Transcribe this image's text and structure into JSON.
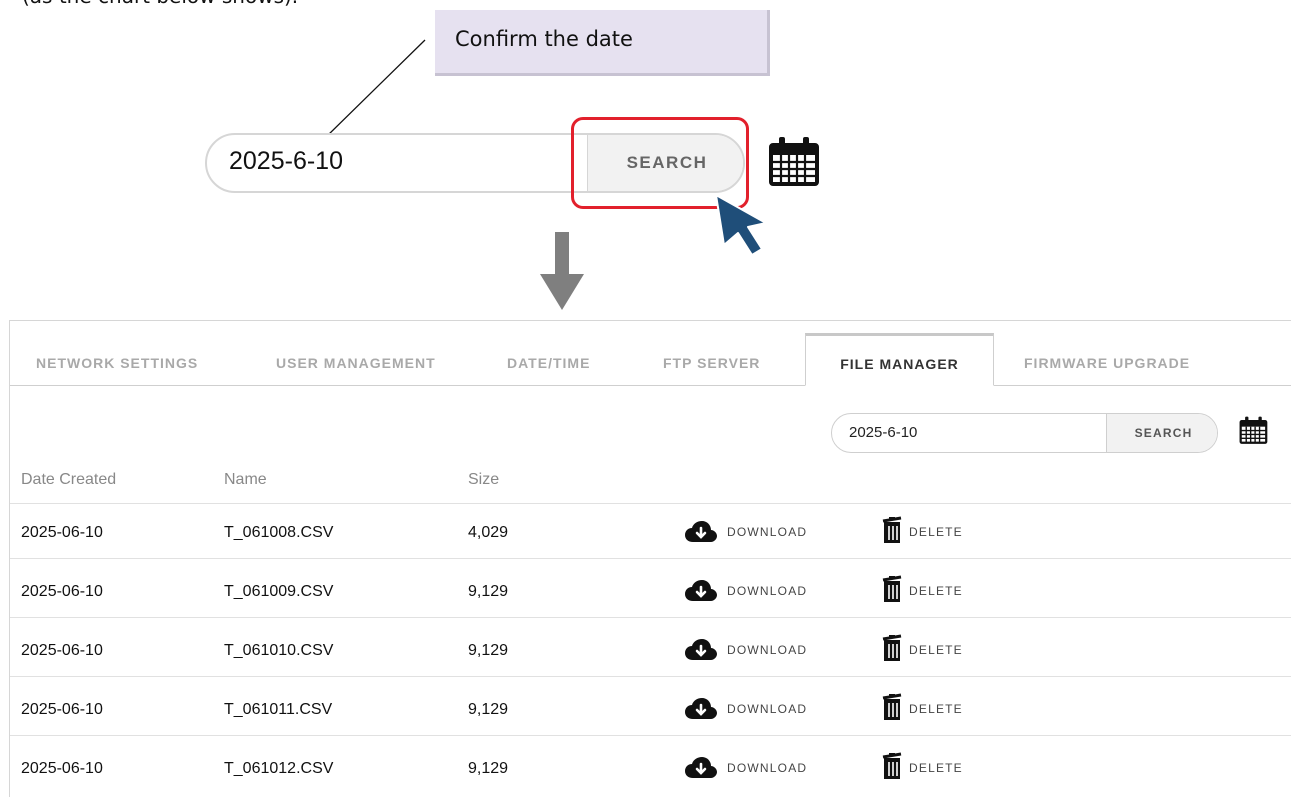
{
  "intro_text": "(as the chart below shows).",
  "callout": {
    "text": "Confirm the date"
  },
  "zoomed_search": {
    "value": "2025-6-10",
    "button_label": "SEARCH",
    "highlight_color": "#e2202c",
    "cursor_color": "#1f4e79"
  },
  "tabs": [
    {
      "label": "NETWORK SETTINGS",
      "active": false
    },
    {
      "label": "USER MANAGEMENT",
      "active": false
    },
    {
      "label": "DATE/TIME",
      "active": false
    },
    {
      "label": "FTP SERVER",
      "active": false
    },
    {
      "label": "FILE MANAGER",
      "active": true
    },
    {
      "label": "FIRMWARE UPGRADE",
      "active": false
    }
  ],
  "search": {
    "value": "2025-6-10",
    "button_label": "SEARCH"
  },
  "table": {
    "headers": [
      "Date Created",
      "Name",
      "Size"
    ],
    "download_label": "DOWNLOAD",
    "delete_label": "DELETE",
    "rows": [
      {
        "date": "2025-06-10",
        "name": "T_061008.CSV",
        "size": "4,029"
      },
      {
        "date": "2025-06-10",
        "name": "T_061009.CSV",
        "size": "9,129"
      },
      {
        "date": "2025-06-10",
        "name": "T_061010.CSV",
        "size": "9,129"
      },
      {
        "date": "2025-06-10",
        "name": "T_061011.CSV",
        "size": "9,129"
      },
      {
        "date": "2025-06-10",
        "name": "T_061012.CSV",
        "size": "9,129"
      }
    ]
  },
  "icons": {
    "calendar": "calendar-icon",
    "download": "cloud-download-icon",
    "delete": "trash-icon",
    "cursor": "mouse-pointer-icon",
    "arrow": "down-arrow-icon"
  }
}
